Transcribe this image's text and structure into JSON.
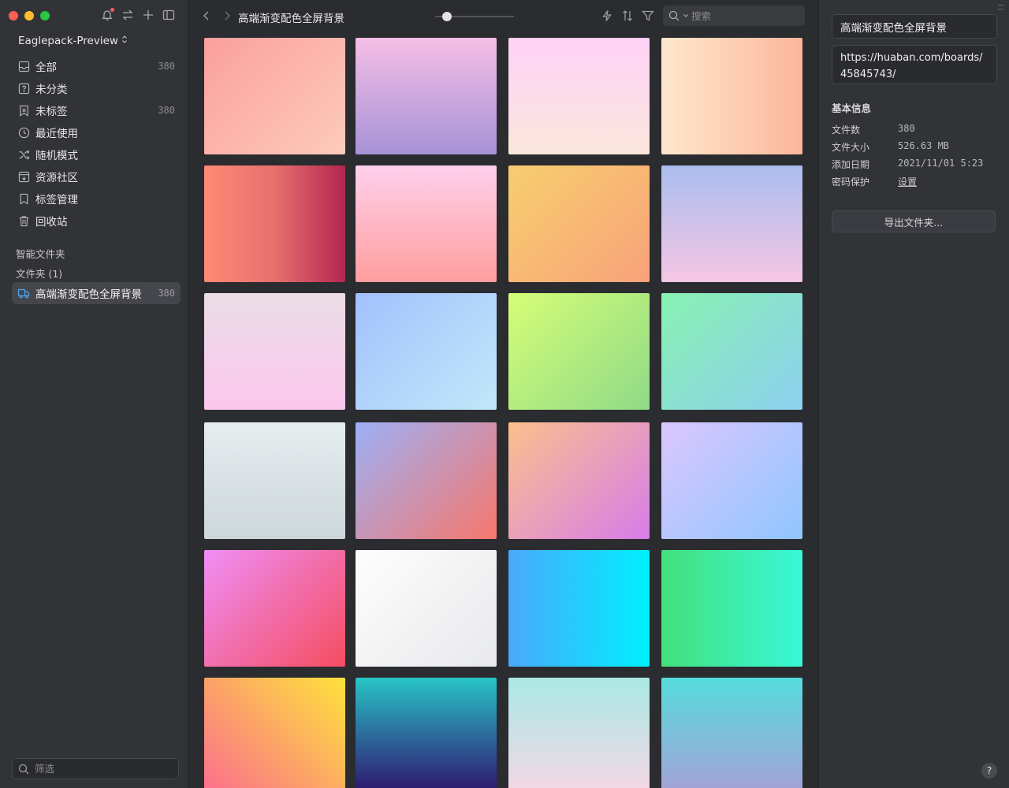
{
  "sidebar": {
    "library_name": "Eaglepack-Preview",
    "nav": [
      {
        "label": "全部",
        "count": "380",
        "icon": "inbox-icon"
      },
      {
        "label": "未分类",
        "count": "",
        "icon": "question-box-icon"
      },
      {
        "label": "未标签",
        "count": "380",
        "icon": "tag-off-icon"
      },
      {
        "label": "最近使用",
        "count": "",
        "icon": "clock-icon"
      },
      {
        "label": "随机模式",
        "count": "",
        "icon": "shuffle-icon"
      },
      {
        "label": "资源社区",
        "count": "",
        "icon": "community-icon"
      },
      {
        "label": "标签管理",
        "count": "",
        "icon": "bookmark-icon"
      },
      {
        "label": "回收站",
        "count": "",
        "icon": "trash-icon"
      }
    ],
    "smart_folders_heading": "智能文件夹",
    "folders_heading": "文件夹 (1)",
    "folder": {
      "label": "高端渐变配色全屏背景",
      "count": "380"
    },
    "filter_placeholder": "筛选"
  },
  "toolbar": {
    "title": "高端渐变配色全屏背景",
    "zoom_level": 0.15,
    "search_placeholder": "搜索"
  },
  "gallery": {
    "tiles": [
      {
        "from": "#fb9f9d",
        "to": "#fccbbb",
        "dir": "135deg"
      },
      {
        "from": "#f5bfe6",
        "to": "#a792d7",
        "dir": "180deg"
      },
      {
        "from": "#fdd2f7",
        "to": "#fce6dc",
        "dir": "180deg"
      },
      {
        "from": "#fee8cd",
        "to": "#fcb69a",
        "dir": "90deg"
      },
      {
        "from": "#ff8a74",
        "to": "#b3264f",
        "dir": "90deg",
        "mid": "#e76f6d"
      },
      {
        "from": "#ffd0ec",
        "to": "#ff9d9d",
        "dir": "180deg"
      },
      {
        "from": "#f7ce6e",
        "to": "#f8a27a",
        "dir": "135deg"
      },
      {
        "from": "#a9bdee",
        "to": "#f6c6e4",
        "dir": "180deg"
      },
      {
        "from": "#ebdde6",
        "to": "#fbc7ed",
        "dir": "180deg"
      },
      {
        "from": "#a2c1fd",
        "to": "#c1e8f9",
        "dir": "135deg"
      },
      {
        "from": "#d5fd76",
        "to": "#8fda88",
        "dir": "135deg"
      },
      {
        "from": "#88f1b1",
        "to": "#8cd0ef",
        "dir": "135deg"
      },
      {
        "from": "#e5edef",
        "to": "#cdd6da",
        "dir": "180deg"
      },
      {
        "from": "#9db0f7",
        "to": "#f7776c",
        "dir": "135deg"
      },
      {
        "from": "#fac08d",
        "to": "#d67de9",
        "dir": "135deg"
      },
      {
        "from": "#dcc6ff",
        "to": "#8fc6fd",
        "dir": "135deg"
      },
      {
        "from": "#ef8ef6",
        "to": "#f54d5f",
        "dir": "135deg"
      },
      {
        "from": "#fdfdfd",
        "to": "#e8e9eb",
        "dir": "135deg"
      },
      {
        "from": "#4aa8fc",
        "to": "#00f0fd",
        "dir": "90deg"
      },
      {
        "from": "#43e07a",
        "to": "#38f8d8",
        "dir": "90deg"
      },
      {
        "from": "#fc6e8e",
        "to": "#fde23b",
        "dir": "45deg"
      },
      {
        "from": "#27c5c6",
        "to": "#2d136b",
        "dir": "180deg",
        "mid": "#2d6a9b"
      },
      {
        "from": "#a9e8e4",
        "to": "#f6d7e5",
        "dir": "180deg"
      },
      {
        "from": "#55dcdc",
        "to": "#a7a0d8",
        "dir": "180deg"
      }
    ]
  },
  "inspector": {
    "folder_name": "高端渐变配色全屏背景",
    "url": "https://huaban.com/boards/45845743/",
    "info_heading": "基本信息",
    "rows": [
      {
        "key": "文件数",
        "value": "380"
      },
      {
        "key": "文件大小",
        "value": "526.63 MB"
      },
      {
        "key": "添加日期",
        "value": "2021/11/01 5:23"
      },
      {
        "key": "密码保护",
        "value": "设置"
      }
    ],
    "export_label": "导出文件夹...",
    "help_label": "?"
  },
  "colors": {
    "sidebar_bg": "#323337",
    "main_bg": "#2b2c30",
    "selected_bg": "#45464b",
    "notification_dot": "#ff5a5a"
  }
}
